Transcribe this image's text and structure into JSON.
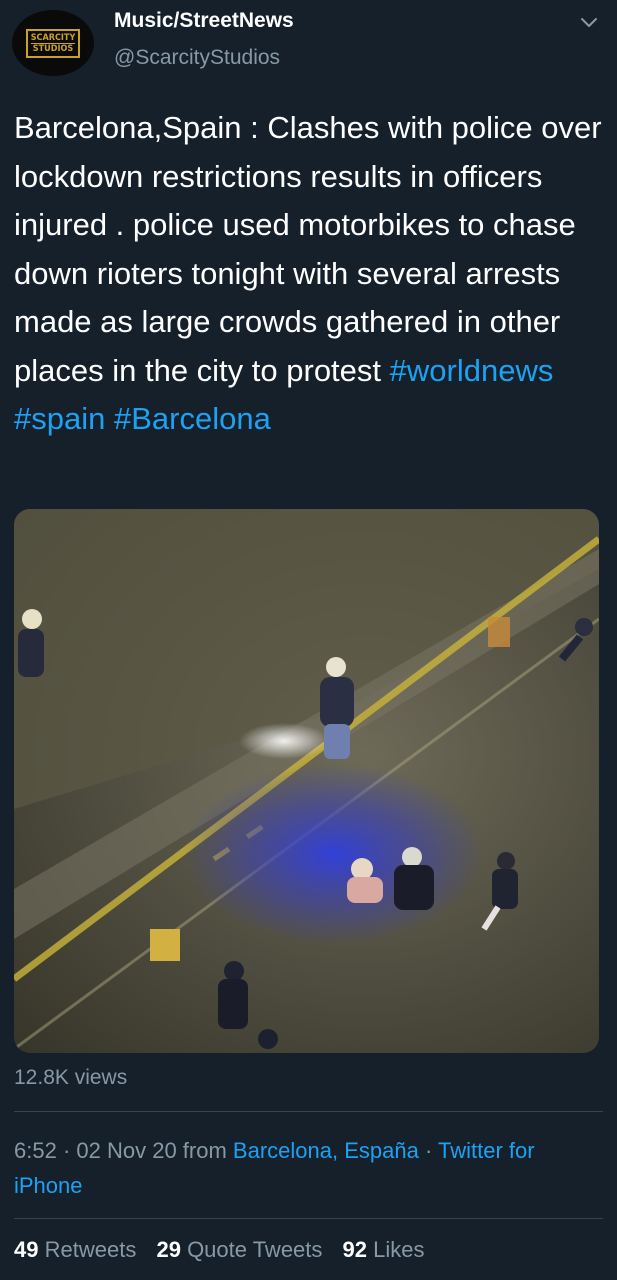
{
  "account": {
    "avatar_line1": "SCARCITY",
    "avatar_line2": "STUDIOS",
    "name": "Music/StreetNews",
    "handle": "@ScarcityStudios"
  },
  "tweet": {
    "text": "Barcelona,Spain : Clashes with police over lockdown restrictions results in officers injured . police used motorbikes to chase down rioters tonight with several arrests made as large crowds gathered in other places in the city to protest",
    "hashtags": [
      "#worldnews",
      "#spain",
      "#Barcelona"
    ]
  },
  "video": {
    "views": "12.8K views"
  },
  "meta": {
    "time": "6:52",
    "sep1": " · ",
    "date": "02 Nov 20",
    "from": " from ",
    "location": "Barcelona, España",
    "sep2": " · ",
    "client": "Twitter for iPhone"
  },
  "stats": {
    "retweets_count": "49",
    "retweets_label": "Retweets",
    "quotes_count": "29",
    "quotes_label": "Quote Tweets",
    "likes_count": "92",
    "likes_label": "Likes"
  },
  "colors": {
    "background": "#15202b",
    "link": "#1da1f2",
    "secondary_text": "#8899a6",
    "avatar_gold": "#c9a227"
  },
  "icons": {
    "menu": "chevron-down-icon"
  }
}
